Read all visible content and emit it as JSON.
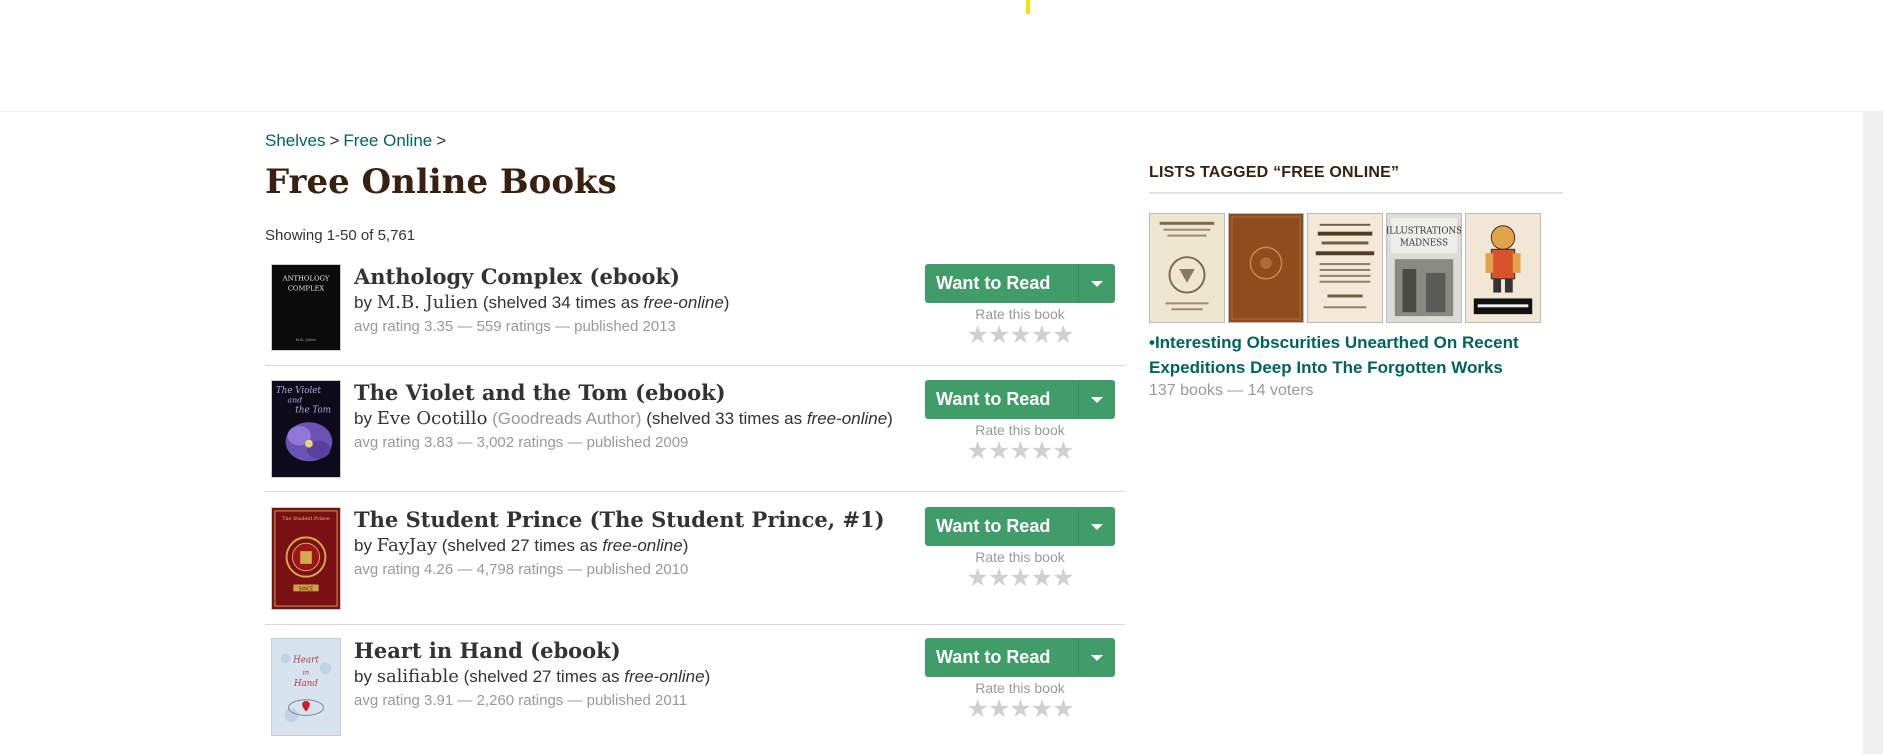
{
  "breadcrumb": {
    "shelves": "Shelves",
    "free_online": "Free Online",
    "sep": ">"
  },
  "page_title": "Free Online Books",
  "showing": "Showing 1-50 of 5,761",
  "rate_label": "Rate this book",
  "want_to_read": "Want to Read",
  "stars": "★★★★★",
  "books": [
    {
      "title": "Anthology Complex (ebook)",
      "by": "by",
      "author": "M.B. Julien",
      "author_badge": "",
      "shelved_prefix": "(shelved 34 times as",
      "shelf": "free-online",
      "shelved_suffix": ")",
      "meta": "avg rating 3.35 — 559 ratings — published 2013",
      "cover_text": "ANTHOLOGY COMPLEX"
    },
    {
      "title": "The Violet and the Tom (ebook)",
      "by": "by",
      "author": "Eve Ocotillo",
      "author_badge": "(Goodreads Author)",
      "shelved_prefix": "(shelved 33 times as",
      "shelf": "free-online",
      "shelved_suffix": ")",
      "meta": "avg rating 3.83 — 3,002 ratings — published 2009",
      "cover_text": "The Violet and the Tom"
    },
    {
      "title": "The Student Prince (The Student Prince, #1)",
      "by": "by",
      "author": "FayJay",
      "author_badge": "",
      "shelved_prefix": "(shelved 27 times as",
      "shelf": "free-online",
      "shelved_suffix": ")",
      "meta": "avg rating 4.26 — 4,798 ratings — published 2010",
      "cover_text": "The Student Prince"
    },
    {
      "title": "Heart in Hand (ebook)",
      "by": "by",
      "author": "salifiable",
      "author_badge": "",
      "shelved_prefix": "(shelved 27 times as",
      "shelf": "free-online",
      "shelved_suffix": ")",
      "meta": "avg rating 3.91 — 2,260 ratings — published 2011",
      "cover_text": "Heart in Hand"
    }
  ],
  "sidebar": {
    "heading": "LISTS TAGGED “FREE ONLINE”",
    "list_title": "•Interesting Obscurities Unearthed On Recent Expeditions Deep Into The Forgotten Works",
    "list_meta": "137 books — 14 voters"
  },
  "colors": {
    "button": "#409d69",
    "link": "#00635d",
    "title": "#382110",
    "muted": "#999999",
    "highlight": "#f4e10f"
  }
}
